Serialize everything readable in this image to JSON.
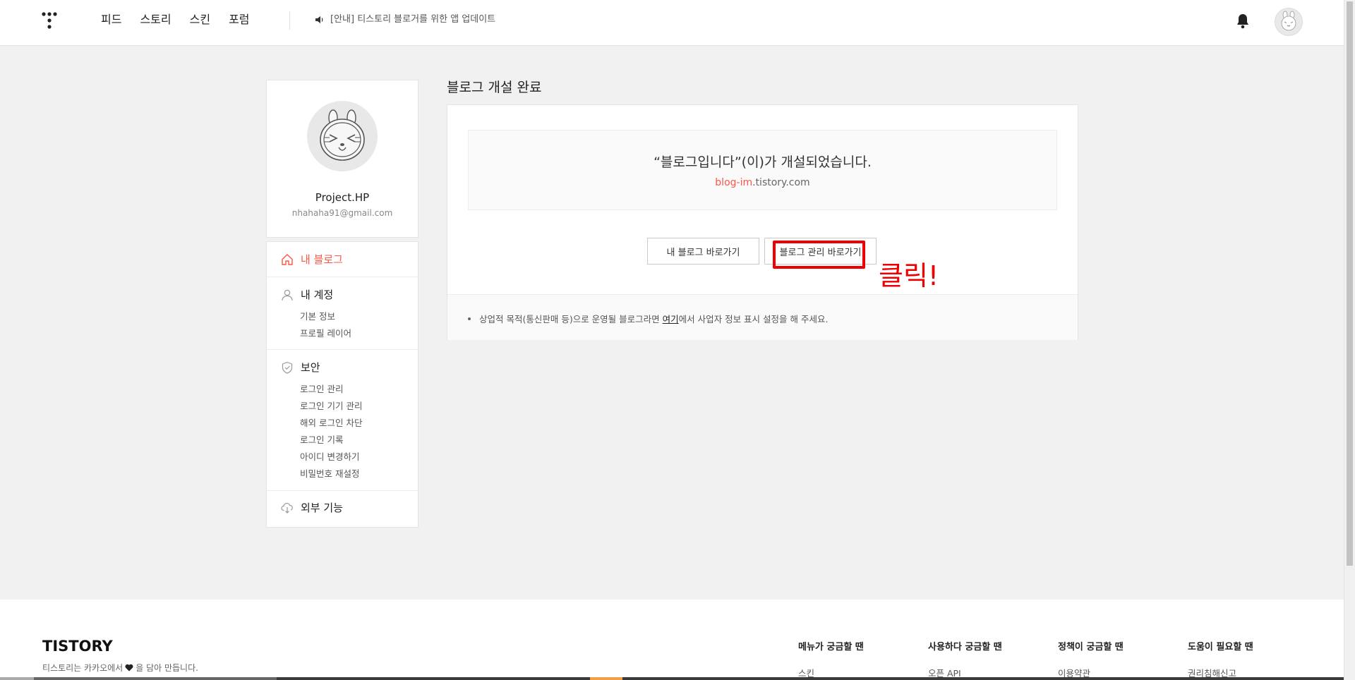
{
  "header": {
    "nav": [
      "피드",
      "스토리",
      "스킨",
      "포럼"
    ],
    "notice": "[안내] 티스토리 블로거를 위한 앱 업데이트"
  },
  "profile": {
    "name": "Project.HP",
    "email": "nhahaha91@gmail.com"
  },
  "menu": {
    "my_blog": "내 블로그",
    "account": {
      "label": "내 계정",
      "items": [
        "기본 정보",
        "프로필 레이어"
      ]
    },
    "security": {
      "label": "보안",
      "items": [
        "로그인 관리",
        "로그인 기기 관리",
        "해외 로그인 차단",
        "로그인 기록",
        "아이디 변경하기",
        "비밀번호 재설정"
      ]
    },
    "external": "외부 기능"
  },
  "main": {
    "title": "블로그 개설 완료",
    "message": "“블로그입니다”(이)가 개설되었습니다.",
    "url_red": "blog-im",
    "url_rest": ".tistory.com",
    "btn_my_blog": "내 블로그 바로가기",
    "btn_manage": "블로그 관리 바로가기",
    "annotation": "클릭!",
    "info_before": "상업적 목적(통신판매 등)으로 운영될 블로그라면 ",
    "info_link": "여기",
    "info_after": "에서 사업자 정보 표시 설정을 해 주세요."
  },
  "footer": {
    "logo": "TISTORY",
    "tagline_before": "티스토리는 카카오에서 ",
    "tagline_after": "을 담아 만듭니다.",
    "columns": [
      {
        "heading": "메뉴가 궁금할 땐",
        "link": "스킨"
      },
      {
        "heading": "사용하다 궁금할 땐",
        "link": "오픈 API"
      },
      {
        "heading": "정책이 궁금할 땐",
        "link": "이용약관"
      },
      {
        "heading": "도움이 필요할 땐",
        "link": "권리침해신고"
      }
    ]
  },
  "colors": {
    "accent": "#ff5544",
    "annotation": "#ee0000"
  },
  "icons": [
    "tistory-logo-icon",
    "speaker-icon",
    "bell-icon",
    "avatar-icon",
    "home-icon",
    "person-icon",
    "shield-icon",
    "cloud-download-icon",
    "heart-icon"
  ]
}
